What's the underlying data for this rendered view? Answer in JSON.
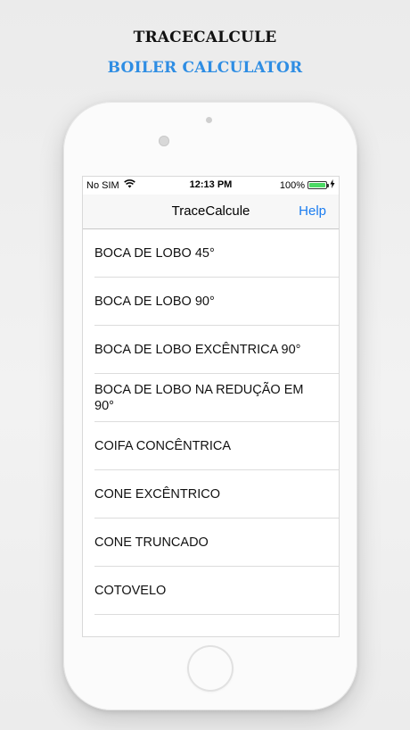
{
  "header": {
    "title": "TRACECALCULE",
    "subtitle": "BOILER CALCULATOR"
  },
  "status_bar": {
    "carrier": "No SIM",
    "time": "12:13 PM",
    "battery": "100%",
    "battery_level": 1.0
  },
  "nav": {
    "title": "TraceCalcule",
    "help_label": "Help"
  },
  "list": {
    "items": [
      {
        "label": "BOCA DE LOBO 45°"
      },
      {
        "label": "BOCA DE LOBO 90°"
      },
      {
        "label": "BOCA DE LOBO EXCÊNTRICA 90°"
      },
      {
        "label": "BOCA DE LOBO NA REDUÇÃO EM 90°"
      },
      {
        "label": "COIFA CONCÊNTRICA"
      },
      {
        "label": "CONE EXCÊNTRICO"
      },
      {
        "label": "CONE TRUNCADO"
      },
      {
        "label": "COTOVELO"
      },
      {
        "label": ""
      }
    ]
  },
  "colors": {
    "accent": "#1a7cf0",
    "subtitle": "#2e8de3",
    "battery": "#4cd964"
  }
}
